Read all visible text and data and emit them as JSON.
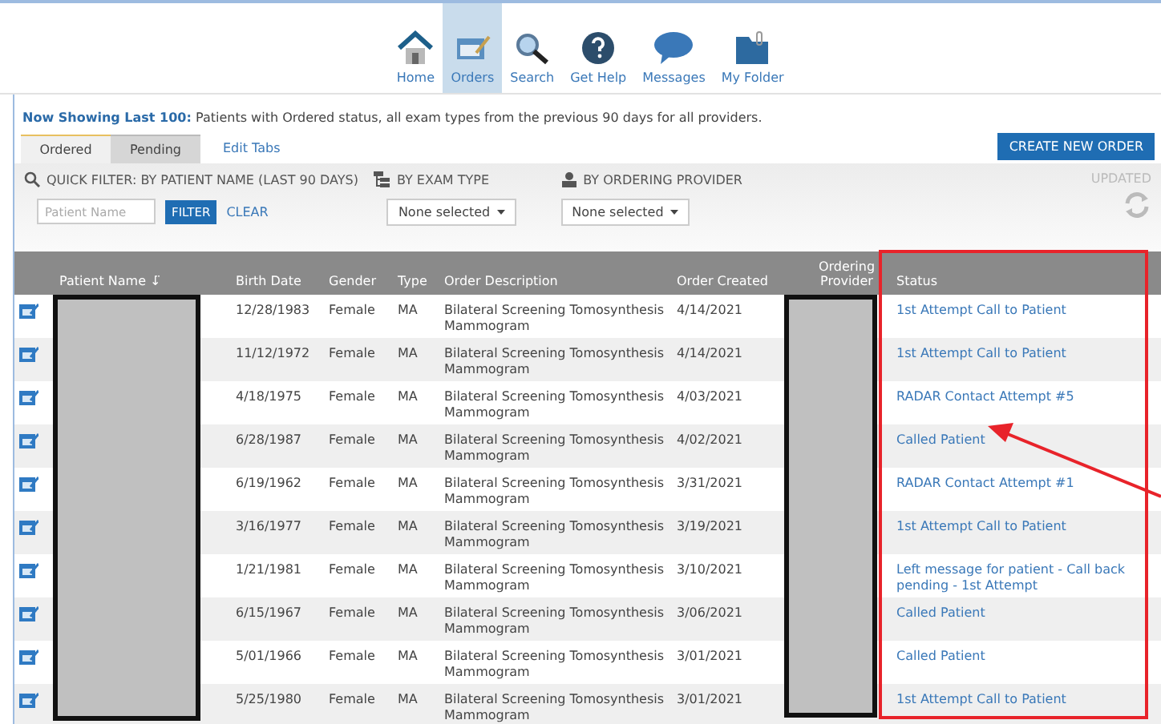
{
  "nav": [
    {
      "label": "Home",
      "kind": "home",
      "selected": false
    },
    {
      "label": "Orders",
      "kind": "orders",
      "selected": true
    },
    {
      "label": "Search",
      "kind": "search",
      "selected": false
    },
    {
      "label": "Get Help",
      "kind": "help",
      "selected": false
    },
    {
      "label": "Messages",
      "kind": "messages",
      "selected": false
    },
    {
      "label": "My Folder",
      "kind": "folder",
      "selected": false
    }
  ],
  "summary": "**Now Showing Last 100:** Patients with Ordered status, all exam types from the previous 90 days for all providers.",
  "tabs": [
    {
      "label": "Ordered",
      "selected": true
    },
    {
      "label": "Pending",
      "selected": false
    }
  ],
  "edit_tabs": "Edit Tabs",
  "create_button": "CREATE NEW ORDER",
  "filters": {
    "quick_filter": "QUICK FILTER: BY PATIENT NAME (LAST 90 DAYS)",
    "patient_placeholder": "Patient Name",
    "filter_button": "FILTER",
    "clear_link": "CLEAR",
    "exam_type": "BY EXAM TYPE",
    "exam_select": "None selected",
    "provider": "BY ORDERING PROVIDER",
    "provider_select": "None selected",
    "updated": "UPDATED"
  },
  "table": {
    "columns": [
      "Patient Name ↓̈",
      "Birth Date",
      "Gender",
      "Type",
      "Order Description",
      "Order Created",
      "Ordering Provider",
      "Status"
    ],
    "rows": [
      {
        "birth": "12/28/1983",
        "gender": "Female",
        "type": "MA",
        "description": "Bilateral Screening Tomosynthesis Mammogram",
        "created": "4/14/2021",
        "status": "1st Attempt Call to Patient"
      },
      {
        "birth": "11/12/1972",
        "gender": "Female",
        "type": "MA",
        "description": "Bilateral Screening Tomosynthesis Mammogram",
        "created": "4/14/2021",
        "status": "1st Attempt Call to Patient"
      },
      {
        "birth": "4/18/1975",
        "gender": "Female",
        "type": "MA",
        "description": "Bilateral Screening Tomosynthesis Mammogram",
        "created": "4/03/2021",
        "status": "RADAR Contact Attempt #5"
      },
      {
        "birth": "6/28/1987",
        "gender": "Female",
        "type": "MA",
        "description": "Bilateral Screening Tomosynthesis Mammogram",
        "created": "4/02/2021",
        "status": "Called Patient"
      },
      {
        "birth": "6/19/1962",
        "gender": "Female",
        "type": "MA",
        "description": "Bilateral Screening Tomosynthesis Mammogram",
        "created": "3/31/2021",
        "status": "RADAR Contact Attempt #1"
      },
      {
        "birth": "3/16/1977",
        "gender": "Female",
        "type": "MA",
        "description": "Bilateral Screening Tomosynthesis Mammogram",
        "created": "3/19/2021",
        "status": "1st Attempt Call to Patient"
      },
      {
        "birth": "1/21/1981",
        "gender": "Female",
        "type": "MA",
        "description": "Bilateral Screening Tomosynthesis Mammogram",
        "created": "3/10/2021",
        "status": "Left message for patient - Call back pending - 1st Attempt"
      },
      {
        "birth": "6/15/1967",
        "gender": "Female",
        "type": "MA",
        "description": "Bilateral Screening Tomosynthesis Mammogram",
        "created": "3/06/2021",
        "status": "Called Patient"
      },
      {
        "birth": "5/01/1966",
        "gender": "Female",
        "type": "MA",
        "description": "Bilateral Screening Tomosynthesis Mammogram",
        "created": "3/01/2021",
        "status": "Called Patient"
      },
      {
        "birth": "5/25/1980",
        "gender": "Female",
        "type": "MA",
        "description": "Bilateral Screening Tomosynthesis Mammogram",
        "created": "3/01/2021",
        "status": "1st Attempt Call to Patient"
      }
    ]
  }
}
